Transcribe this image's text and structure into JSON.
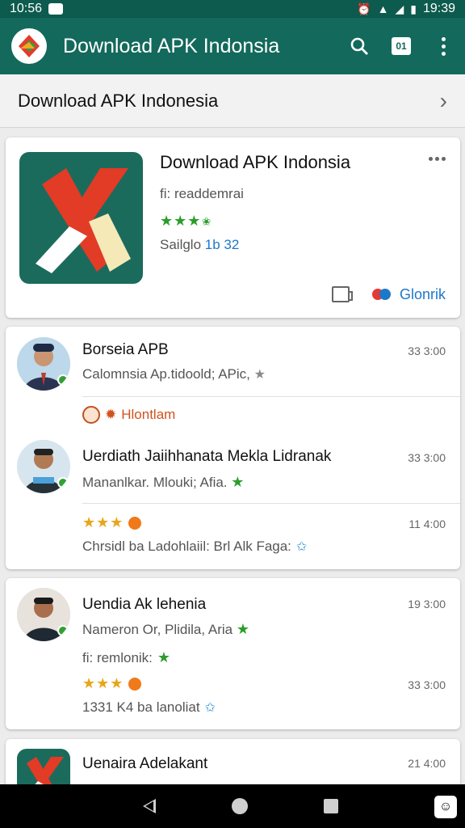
{
  "status_bar": {
    "time_left": "10:56",
    "time_right": "19:39"
  },
  "app_bar": {
    "title": "Download APK Indonsia"
  },
  "sub_header": {
    "title": "Download APK Indonesia"
  },
  "featured": {
    "title": "Download APK Indonsia",
    "developer": "fi: readdemrai",
    "rating": 3.5,
    "size_label": "Sailglo",
    "size_value": "1b 32",
    "download_label": "Glonrik"
  },
  "list": [
    {
      "title": "Borseia APB",
      "subtitle": "Calomnsia Ap.tidoold; APic,",
      "time": "33 3:00"
    },
    {
      "tag": "Hlontlam"
    },
    {
      "title": "Uerdiath Jaiihhanata Mekla Lidranak",
      "subtitle": "Mananlkar. Mlouki; Afia.",
      "time": "33 3:00"
    },
    {
      "rating": 3.5,
      "time": "11 4:00",
      "line": "Chrsidl ba Ladohlaiil: Brl Alk Faga:"
    },
    {
      "title": "Uendia Ak lehenia",
      "subtitle": "Nameron Or, Plidila, Aria",
      "time": "19 3:00"
    },
    {
      "line": "fi: remlonik:",
      "rating": 3.5,
      "time": "33 3:00"
    },
    {
      "line2": "1331 K4 ba lanoliat"
    },
    {
      "title": "Uenaira Adelakant",
      "time": "21 4:00"
    }
  ]
}
